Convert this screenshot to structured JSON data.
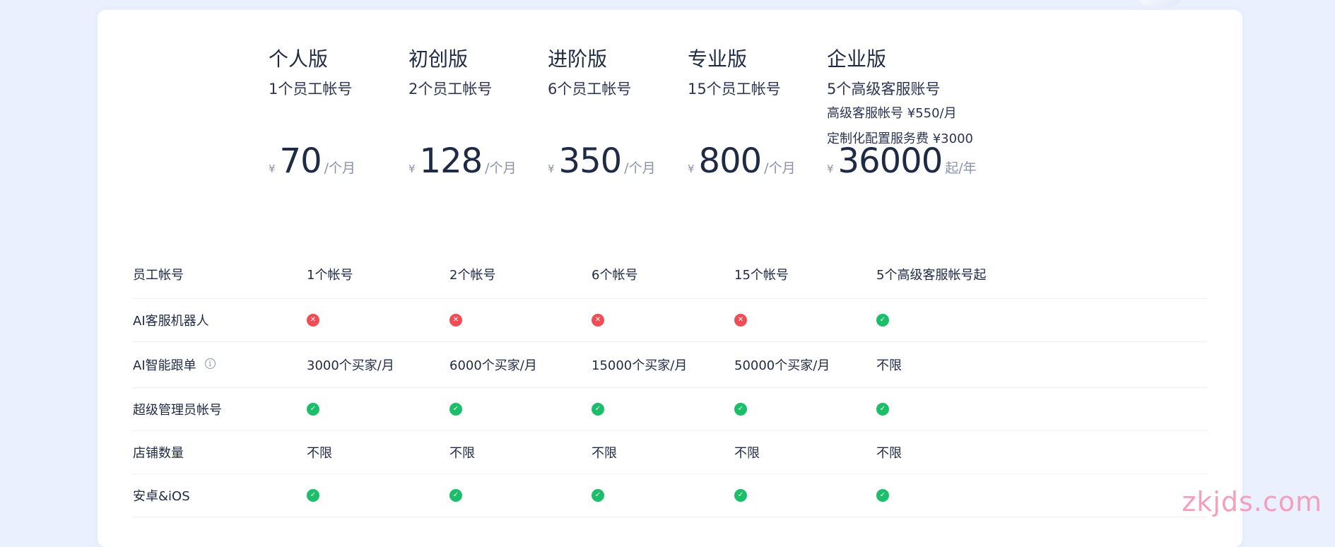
{
  "plans": [
    {
      "name": "个人版",
      "seats": "1个员工帐号",
      "extra": [],
      "currency": "¥",
      "amount": "70",
      "unit": "/个月"
    },
    {
      "name": "初创版",
      "seats": "2个员工帐号",
      "extra": [],
      "currency": "¥",
      "amount": "128",
      "unit": "/个月"
    },
    {
      "name": "进阶版",
      "seats": "6个员工帐号",
      "extra": [],
      "currency": "¥",
      "amount": "350",
      "unit": "/个月"
    },
    {
      "name": "专业版",
      "seats": "15个员工帐号",
      "extra": [],
      "currency": "¥",
      "amount": "800",
      "unit": "/个月"
    },
    {
      "name": "企业版",
      "seats": "5个高级客服账号",
      "extra": [
        "高级客服帐号 ¥550/月",
        "定制化配置服务费 ¥3000"
      ],
      "currency": "¥",
      "amount": "36000",
      "unit": "起/年"
    }
  ],
  "features": [
    {
      "label": "员工帐号",
      "info": false,
      "values": [
        "1个帐号",
        "2个帐号",
        "6个帐号",
        "15个帐号",
        "5个高级客服帐号起"
      ]
    },
    {
      "label": "AI客服机器人",
      "info": false,
      "values": [
        "no",
        "no",
        "no",
        "no",
        "yes"
      ]
    },
    {
      "label": "AI智能跟单",
      "info": true,
      "values": [
        "3000个买家/月",
        "6000个买家/月",
        "15000个买家/月",
        "50000个买家/月",
        "不限"
      ]
    },
    {
      "label": "超级管理员帐号",
      "info": false,
      "values": [
        "yes",
        "yes",
        "yes",
        "yes",
        "yes"
      ]
    },
    {
      "label": "店铺数量",
      "info": false,
      "values": [
        "不限",
        "不限",
        "不限",
        "不限",
        "不限"
      ]
    },
    {
      "label": "安卓&iOS",
      "info": false,
      "values": [
        "yes",
        "yes",
        "yes",
        "yes",
        "yes"
      ]
    }
  ],
  "icons": {
    "yes": "check-circle-icon",
    "no": "x-circle-icon",
    "info": "info-icon"
  },
  "colors": {
    "yes": "#1dbe6a",
    "no": "#f04e55"
  },
  "watermark": "zkjds.com"
}
